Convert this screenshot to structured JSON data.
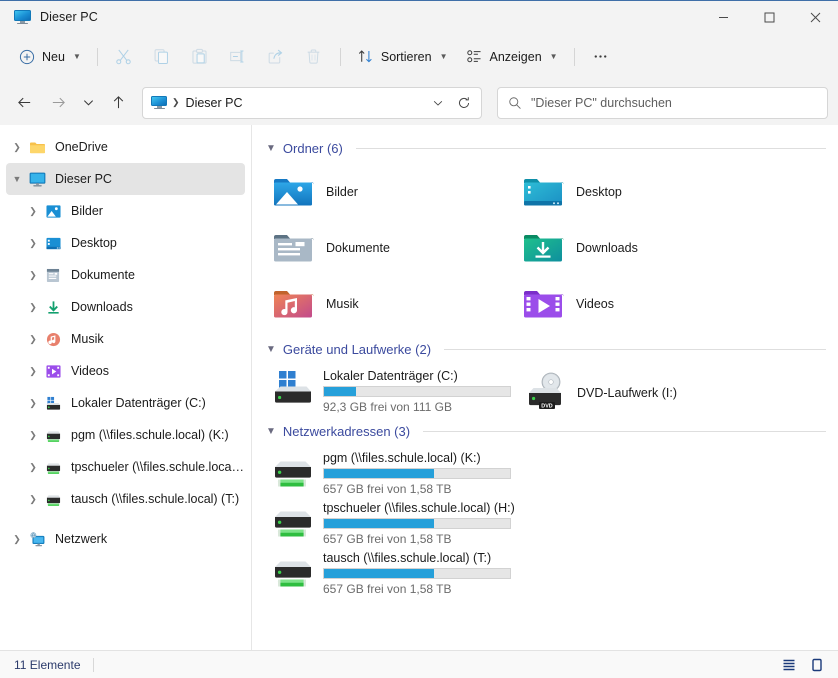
{
  "window": {
    "title": "Dieser PC",
    "title_icon": "monitor-icon",
    "minimize_label": "Minimieren",
    "maximize_label": "Maximieren",
    "close_label": "Schließen"
  },
  "toolbar": {
    "new_label": "Neu",
    "sort_label": "Sortieren",
    "view_label": "Anzeigen",
    "more_label": "Weitere Optionen",
    "items": [
      {
        "name": "cut-icon",
        "label": "Ausschneiden",
        "enabled": false
      },
      {
        "name": "copy-icon",
        "label": "Kopieren",
        "enabled": false
      },
      {
        "name": "paste-icon",
        "label": "Einfügen",
        "enabled": false
      },
      {
        "name": "rename-icon",
        "label": "Umbenennen",
        "enabled": false
      },
      {
        "name": "share-icon",
        "label": "Freigeben",
        "enabled": false
      },
      {
        "name": "delete-icon",
        "label": "Löschen",
        "enabled": false
      }
    ]
  },
  "navbar": {
    "back_label": "Zurück",
    "forward_label": "Vorwärts",
    "recent_label": "Zuletzt verwendete Orte",
    "up_label": "Nach oben",
    "breadcrumb": "Dieser PC",
    "refresh_label": "Aktualisieren",
    "dropdown_label": "Vorherige Orte"
  },
  "search": {
    "placeholder": "\"Dieser PC\" durchsuchen",
    "value": ""
  },
  "sidebar": {
    "items": [
      {
        "label": "OneDrive",
        "icon": "onedrive-folder-icon",
        "level": 1,
        "expanded": false,
        "selected": false
      },
      {
        "label": "Dieser PC",
        "icon": "monitor-icon",
        "level": 1,
        "expanded": true,
        "selected": true
      },
      {
        "label": "Bilder",
        "icon": "pictures-icon",
        "level": 2,
        "expanded": false,
        "selected": false
      },
      {
        "label": "Desktop",
        "icon": "desktop-icon",
        "level": 2,
        "expanded": false,
        "selected": false
      },
      {
        "label": "Dokumente",
        "icon": "documents-icon",
        "level": 2,
        "expanded": false,
        "selected": false
      },
      {
        "label": "Downloads",
        "icon": "downloads-icon",
        "level": 2,
        "expanded": false,
        "selected": false
      },
      {
        "label": "Musik",
        "icon": "music-icon",
        "level": 2,
        "expanded": false,
        "selected": false
      },
      {
        "label": "Videos",
        "icon": "videos-icon",
        "level": 2,
        "expanded": false,
        "selected": false
      },
      {
        "label": "Lokaler Datenträger (C:)",
        "icon": "local-drive-icon",
        "level": 2,
        "expanded": false,
        "selected": false
      },
      {
        "label": "pgm (\\\\files.schule.local) (K:)",
        "icon": "network-drive-icon",
        "level": 2,
        "expanded": false,
        "selected": false
      },
      {
        "label": "tpschueler (\\\\files.schule.local) (H:)",
        "icon": "network-drive-icon",
        "level": 2,
        "expanded": false,
        "selected": false
      },
      {
        "label": "tausch (\\\\files.schule.local) (T:)",
        "icon": "network-drive-icon",
        "level": 2,
        "expanded": false,
        "selected": false
      },
      {
        "label": "Netzwerk",
        "icon": "network-icon",
        "level": 1,
        "expanded": false,
        "selected": false
      }
    ]
  },
  "content": {
    "sections": [
      {
        "title": "Ordner (6)",
        "expanded": true
      },
      {
        "title": "Geräte und Laufwerke (2)",
        "expanded": true
      },
      {
        "title": "Netzwerkadressen (3)",
        "expanded": true
      }
    ],
    "folders": [
      {
        "label": "Bilder",
        "icon": "pictures-folder-icon"
      },
      {
        "label": "Desktop",
        "icon": "desktop-folder-icon"
      },
      {
        "label": "Dokumente",
        "icon": "documents-folder-icon"
      },
      {
        "label": "Downloads",
        "icon": "downloads-folder-icon"
      },
      {
        "label": "Musik",
        "icon": "music-folder-icon"
      },
      {
        "label": "Videos",
        "icon": "videos-folder-icon"
      }
    ],
    "drives": [
      {
        "name": "Lokaler Datenträger (C:)",
        "icon": "local-drive-icon",
        "free_text": "92,3 GB frei von 111 GB",
        "used_percent": 17,
        "has_bar": true
      },
      {
        "name": "DVD-Laufwerk (I:)",
        "icon": "dvd-drive-icon",
        "free_text": "",
        "used_percent": 0,
        "has_bar": false
      }
    ],
    "network_drives": [
      {
        "name": "pgm (\\\\files.schule.local) (K:)",
        "icon": "network-drive-icon",
        "free_text": "657 GB frei von 1,58 TB",
        "used_percent": 59,
        "has_bar": true
      },
      {
        "name": "tpschueler (\\\\files.schule.local) (H:)",
        "icon": "network-drive-icon",
        "free_text": "657 GB frei von 1,58 TB",
        "used_percent": 59,
        "has_bar": true
      },
      {
        "name": "tausch (\\\\files.schule.local) (T:)",
        "icon": "network-drive-icon",
        "free_text": "657 GB frei von 1,58 TB",
        "used_percent": 59,
        "has_bar": true
      }
    ]
  },
  "statusbar": {
    "item_count": "11 Elemente",
    "details_view_label": "Detailansicht",
    "tiles_view_label": "Kachelansicht"
  },
  "colors": {
    "accent": "#26a0da",
    "section_header": "#3b4a9e",
    "status_text": "#2b3a6b",
    "selection": "#e4e4e4",
    "window_bg": "#f3f3f3"
  }
}
